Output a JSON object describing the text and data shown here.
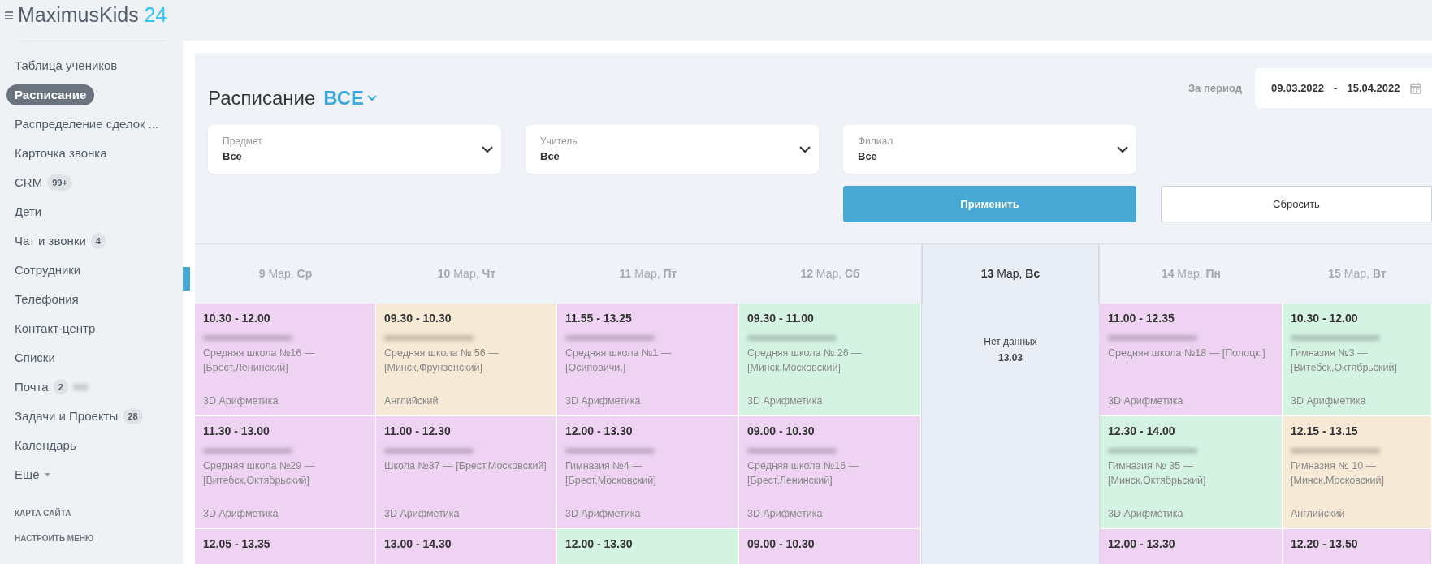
{
  "sidebar": {
    "logo": {
      "name": "MaximusKids",
      "number": "24"
    },
    "items": [
      {
        "label": "Таблица учеников",
        "selected": false,
        "kind": "link"
      },
      {
        "label": "Расписание",
        "selected": true,
        "kind": "link"
      },
      {
        "label": "Распределение сделок ...",
        "selected": false,
        "kind": "link"
      },
      {
        "label": "Карточка звонка",
        "selected": false,
        "kind": "link"
      },
      {
        "label": "CRM",
        "selected": false,
        "kind": "link",
        "badge": "99+"
      },
      {
        "label": "Дети",
        "selected": false,
        "kind": "link"
      },
      {
        "label": "Чат и звонки",
        "selected": false,
        "kind": "link",
        "badge": "4"
      },
      {
        "label": "Сотрудники",
        "selected": false,
        "kind": "link"
      },
      {
        "label": "Телефония",
        "selected": false,
        "kind": "link"
      },
      {
        "label": "Контакт-центр",
        "selected": false,
        "kind": "link"
      },
      {
        "label": "Списки",
        "selected": false,
        "kind": "link"
      },
      {
        "label": "Почта",
        "selected": false,
        "kind": "link",
        "badge": "2"
      },
      {
        "label": "Задачи и Проекты",
        "selected": false,
        "kind": "link",
        "badge": "28"
      },
      {
        "label": "Календарь",
        "selected": false,
        "kind": "link"
      },
      {
        "label": "Ещё",
        "selected": false,
        "kind": "more"
      }
    ],
    "footer_links": [
      "КАРТА САЙТА",
      "НАСТРОИТЬ МЕНЮ"
    ]
  },
  "schedule": {
    "title": "Расписание",
    "scope": "ВСЕ",
    "period_label": "За период",
    "date_from": "09.03.2022",
    "date_separator": "-",
    "date_to": "15.04.2022",
    "filters": [
      {
        "label": "Предмет",
        "value": "Все"
      },
      {
        "label": "Учитель",
        "value": "Все"
      },
      {
        "label": "Филиал",
        "value": "Все"
      }
    ],
    "apply_button": "Применить",
    "reset_button": "Сбросить",
    "days": [
      {
        "label": "**9** Мар, **Ср**",
        "selected": false,
        "lessons": [
          {
            "time": "10.30 - 12.00",
            "school": "Средняя школа №16 — [Брест,Ленинский]",
            "subject": "3D Арифметика",
            "color": "#eed3f3"
          },
          {
            "time": "11.30 - 13.00",
            "school": "Средняя школа №29 — [Витебск,Октябрьский]",
            "subject": "3D Арифметика",
            "color": "#eed3f3"
          },
          {
            "time": "12.05 - 13.35",
            "color": "#eed3f3"
          }
        ]
      },
      {
        "label": "**10** Мар, **Чт**",
        "selected": false,
        "lessons": [
          {
            "time": "09.30 - 10.30",
            "school": "Средняя школа № 56 — [Минск,Фрунзенский]",
            "subject": "Английский",
            "color": "#f6e9d5"
          },
          {
            "time": "11.00 - 12.30",
            "school": "Школа №37 — [Брест,Московский]",
            "subject": "3D Арифметика",
            "color": "#eed3f3"
          },
          {
            "time": "13.00 - 14.30",
            "color": "#eed3f3"
          }
        ]
      },
      {
        "label": "**11** Мар, **Пт**",
        "selected": false,
        "lessons": [
          {
            "time": "11.55 - 13.25",
            "school": "Средняя школа №1 — [Осиповичи,]",
            "subject": "3D Арифметика",
            "color": "#eed3f3"
          },
          {
            "time": "12.00 - 13.30",
            "school": "Гимназия №4 — [Брест,Московский]",
            "subject": "3D Арифметика",
            "color": "#eed3f3"
          },
          {
            "time": "12.00 - 13.30",
            "color": "#d5f3e3"
          }
        ]
      },
      {
        "label": "**12** Мар, **Сб**",
        "selected": false,
        "lessons": [
          {
            "time": "09.30 - 11.00",
            "school": "Средняя школа № 26 — [Минск,Московский]",
            "subject": "3D Арифметика",
            "color": "#d5f3e3"
          },
          {
            "time": "09.00 - 10.30",
            "school": "Средняя школа №16 — [Брест,Ленинский]",
            "subject": "3D Арифметика",
            "color": "#eed3f3"
          },
          {
            "time": "09.00 - 10.30",
            "color": "#eed3f3"
          }
        ]
      },
      {
        "label": "**13** Мар, **Вс**",
        "selected": true,
        "empty_text": "Нет данных",
        "empty_date": "13.03"
      },
      {
        "label": "**14** Мар, **Пн**",
        "selected": false,
        "lessons": [
          {
            "time": "11.00 - 12.35",
            "school": "Средняя школа №18 — [Полоцк,]",
            "subject": "3D Арифметика",
            "color": "#eed3f3"
          },
          {
            "time": "12.30 - 14.00",
            "school": "Гимназия № 35 — [Минск,Октябрьский]",
            "subject": "3D Арифметика",
            "color": "#d5f3e3"
          },
          {
            "time": "12.00 - 13.30",
            "color": "#eed3f3"
          }
        ]
      },
      {
        "label": "**15** Мар, **Вт**",
        "selected": false,
        "lessons": [
          {
            "time": "10.30 - 12.00",
            "school": "Гимназия №3 — [Витебск,Октябрьский]",
            "subject": "3D Арифметика",
            "color": "#d5f3e3"
          },
          {
            "time": "12.15 - 13.15",
            "school": "Гимназия № 10 — [Минск,Московский]",
            "subject": "Английский",
            "color": "#f6e9d5"
          },
          {
            "time": "12.20 - 13.50",
            "color": "#eed3f3"
          }
        ]
      }
    ]
  }
}
